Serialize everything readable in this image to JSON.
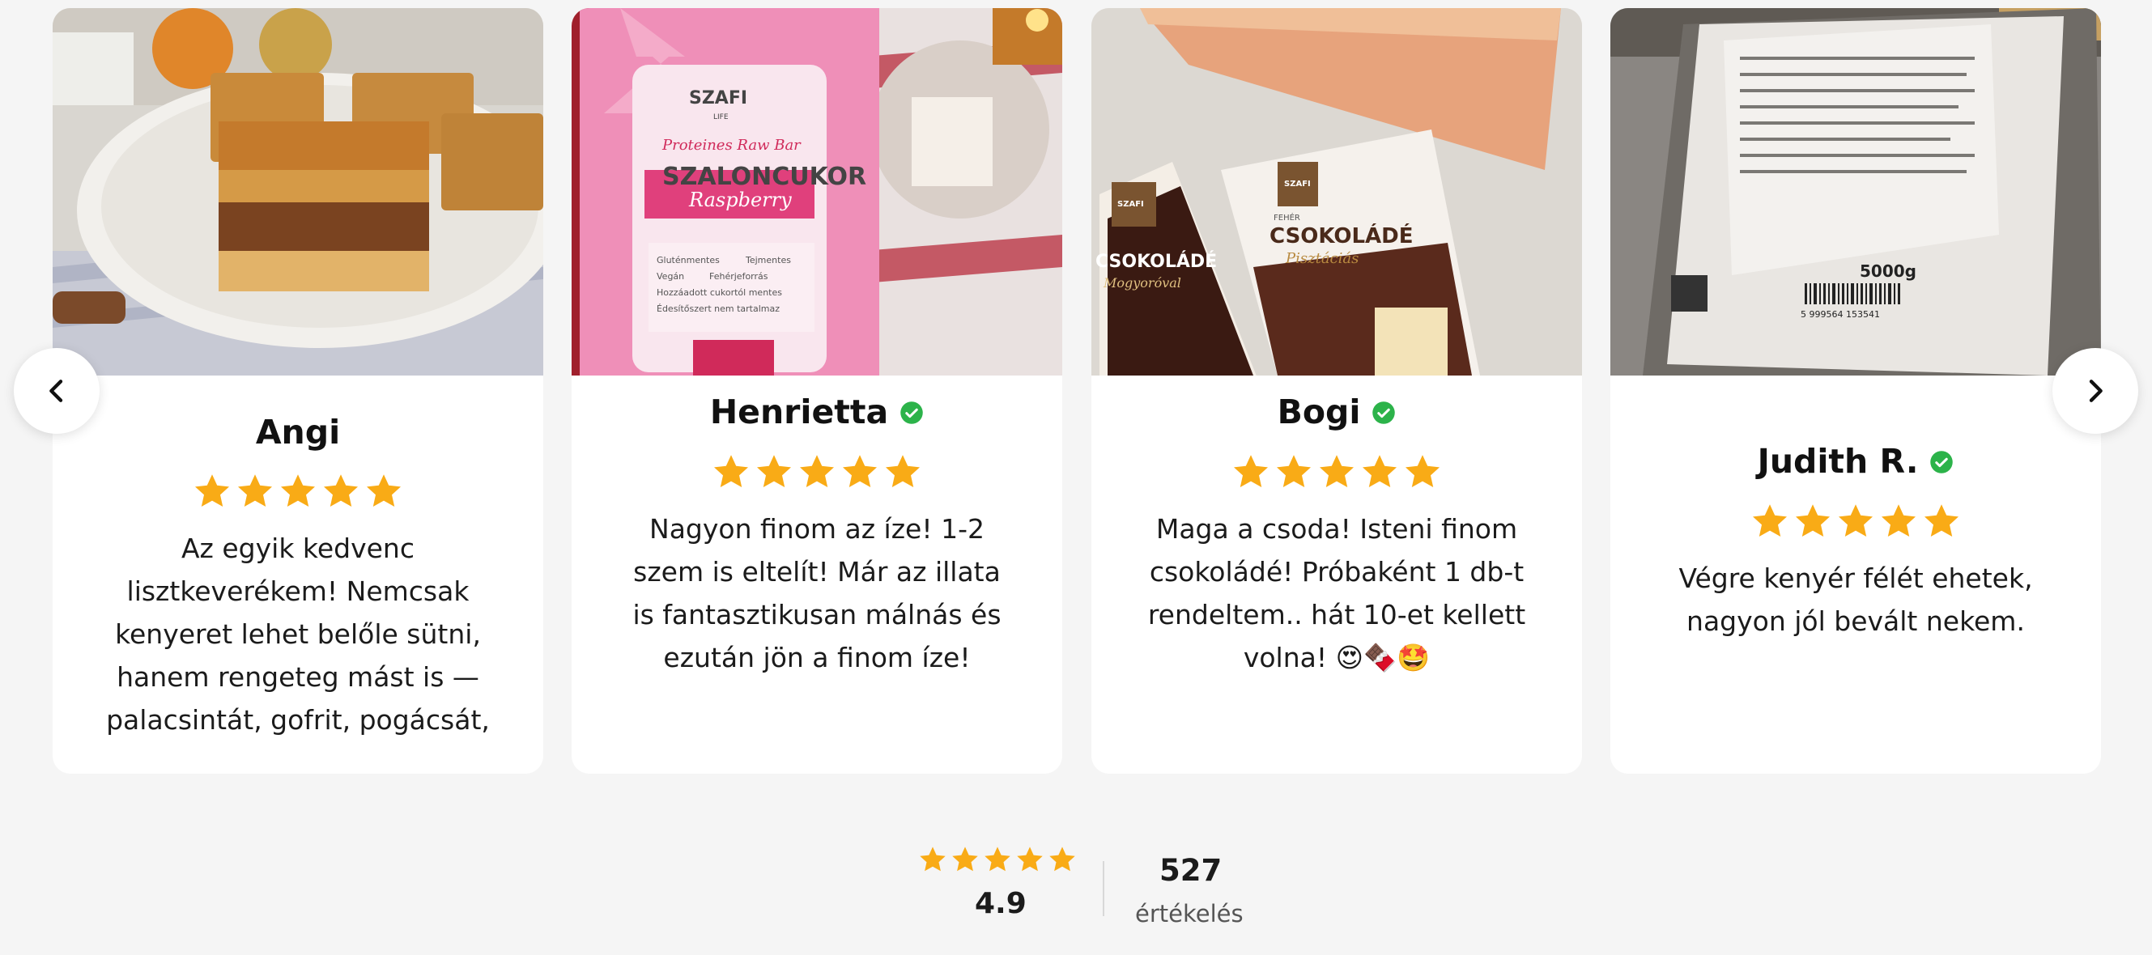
{
  "reviews": [
    {
      "name": "Angi",
      "verified": false,
      "rating": 5,
      "text": "Az egyik kedvenc lisztkeverékem! Nemcsak kenyeret lehet belőle sütni, hanem rengeteg mást is — palacsintát, gofrit, pogácsát,"
    },
    {
      "name": "Henrietta",
      "verified": true,
      "rating": 5,
      "text": "Nagyon finom az íze! 1-2 szem is eltelít! Már az illata is fantasztikusan málnás és ezután jön a finom íze!"
    },
    {
      "name": "Bogi",
      "verified": true,
      "rating": 5,
      "text": "Maga a csoda! Isteni finom csokoládé! Próbaként 1 db-t rendeltem.. hát 10-et kellett volna! 😍🍫🤩"
    },
    {
      "name": "Judith R.",
      "verified": true,
      "rating": 5,
      "text": "Végre kenyér félét ehetek, nagyon jól bevált nekem."
    }
  ],
  "product_labels": {
    "card2_brand": "SZAFI",
    "card2_sub": "LIFE",
    "card2_line1": "Proteines Raw Bar",
    "card2_line2": "SZALONCUKOR",
    "card2_line3": "Raspberry",
    "card2_checks": [
      "Gluténmentes",
      "Tejmentes",
      "Vegán",
      "Fehérjeforrás",
      "Hozzáadott cukortól mentes",
      "Édesítőszert nem tartalmaz"
    ],
    "card3_brand": "SZAFI",
    "card3_bar1": "CSOKOLÁDÉ",
    "card3_bar1_sub": "Mogyoróval",
    "card3_bar2_top": "FEHÉR",
    "card3_bar2": "CSOKOLÁDÉ",
    "card3_bar2_sub": "Pisztáciás",
    "card4_weight": "5000g",
    "card4_barcode": "5 999564 153541"
  },
  "summary": {
    "average": "4.9",
    "count": "527",
    "count_label": "értékelés",
    "stars": 5
  },
  "colors": {
    "star": "#f9ab16",
    "verified": "#2cb34a",
    "background": "#f5f5f5"
  }
}
